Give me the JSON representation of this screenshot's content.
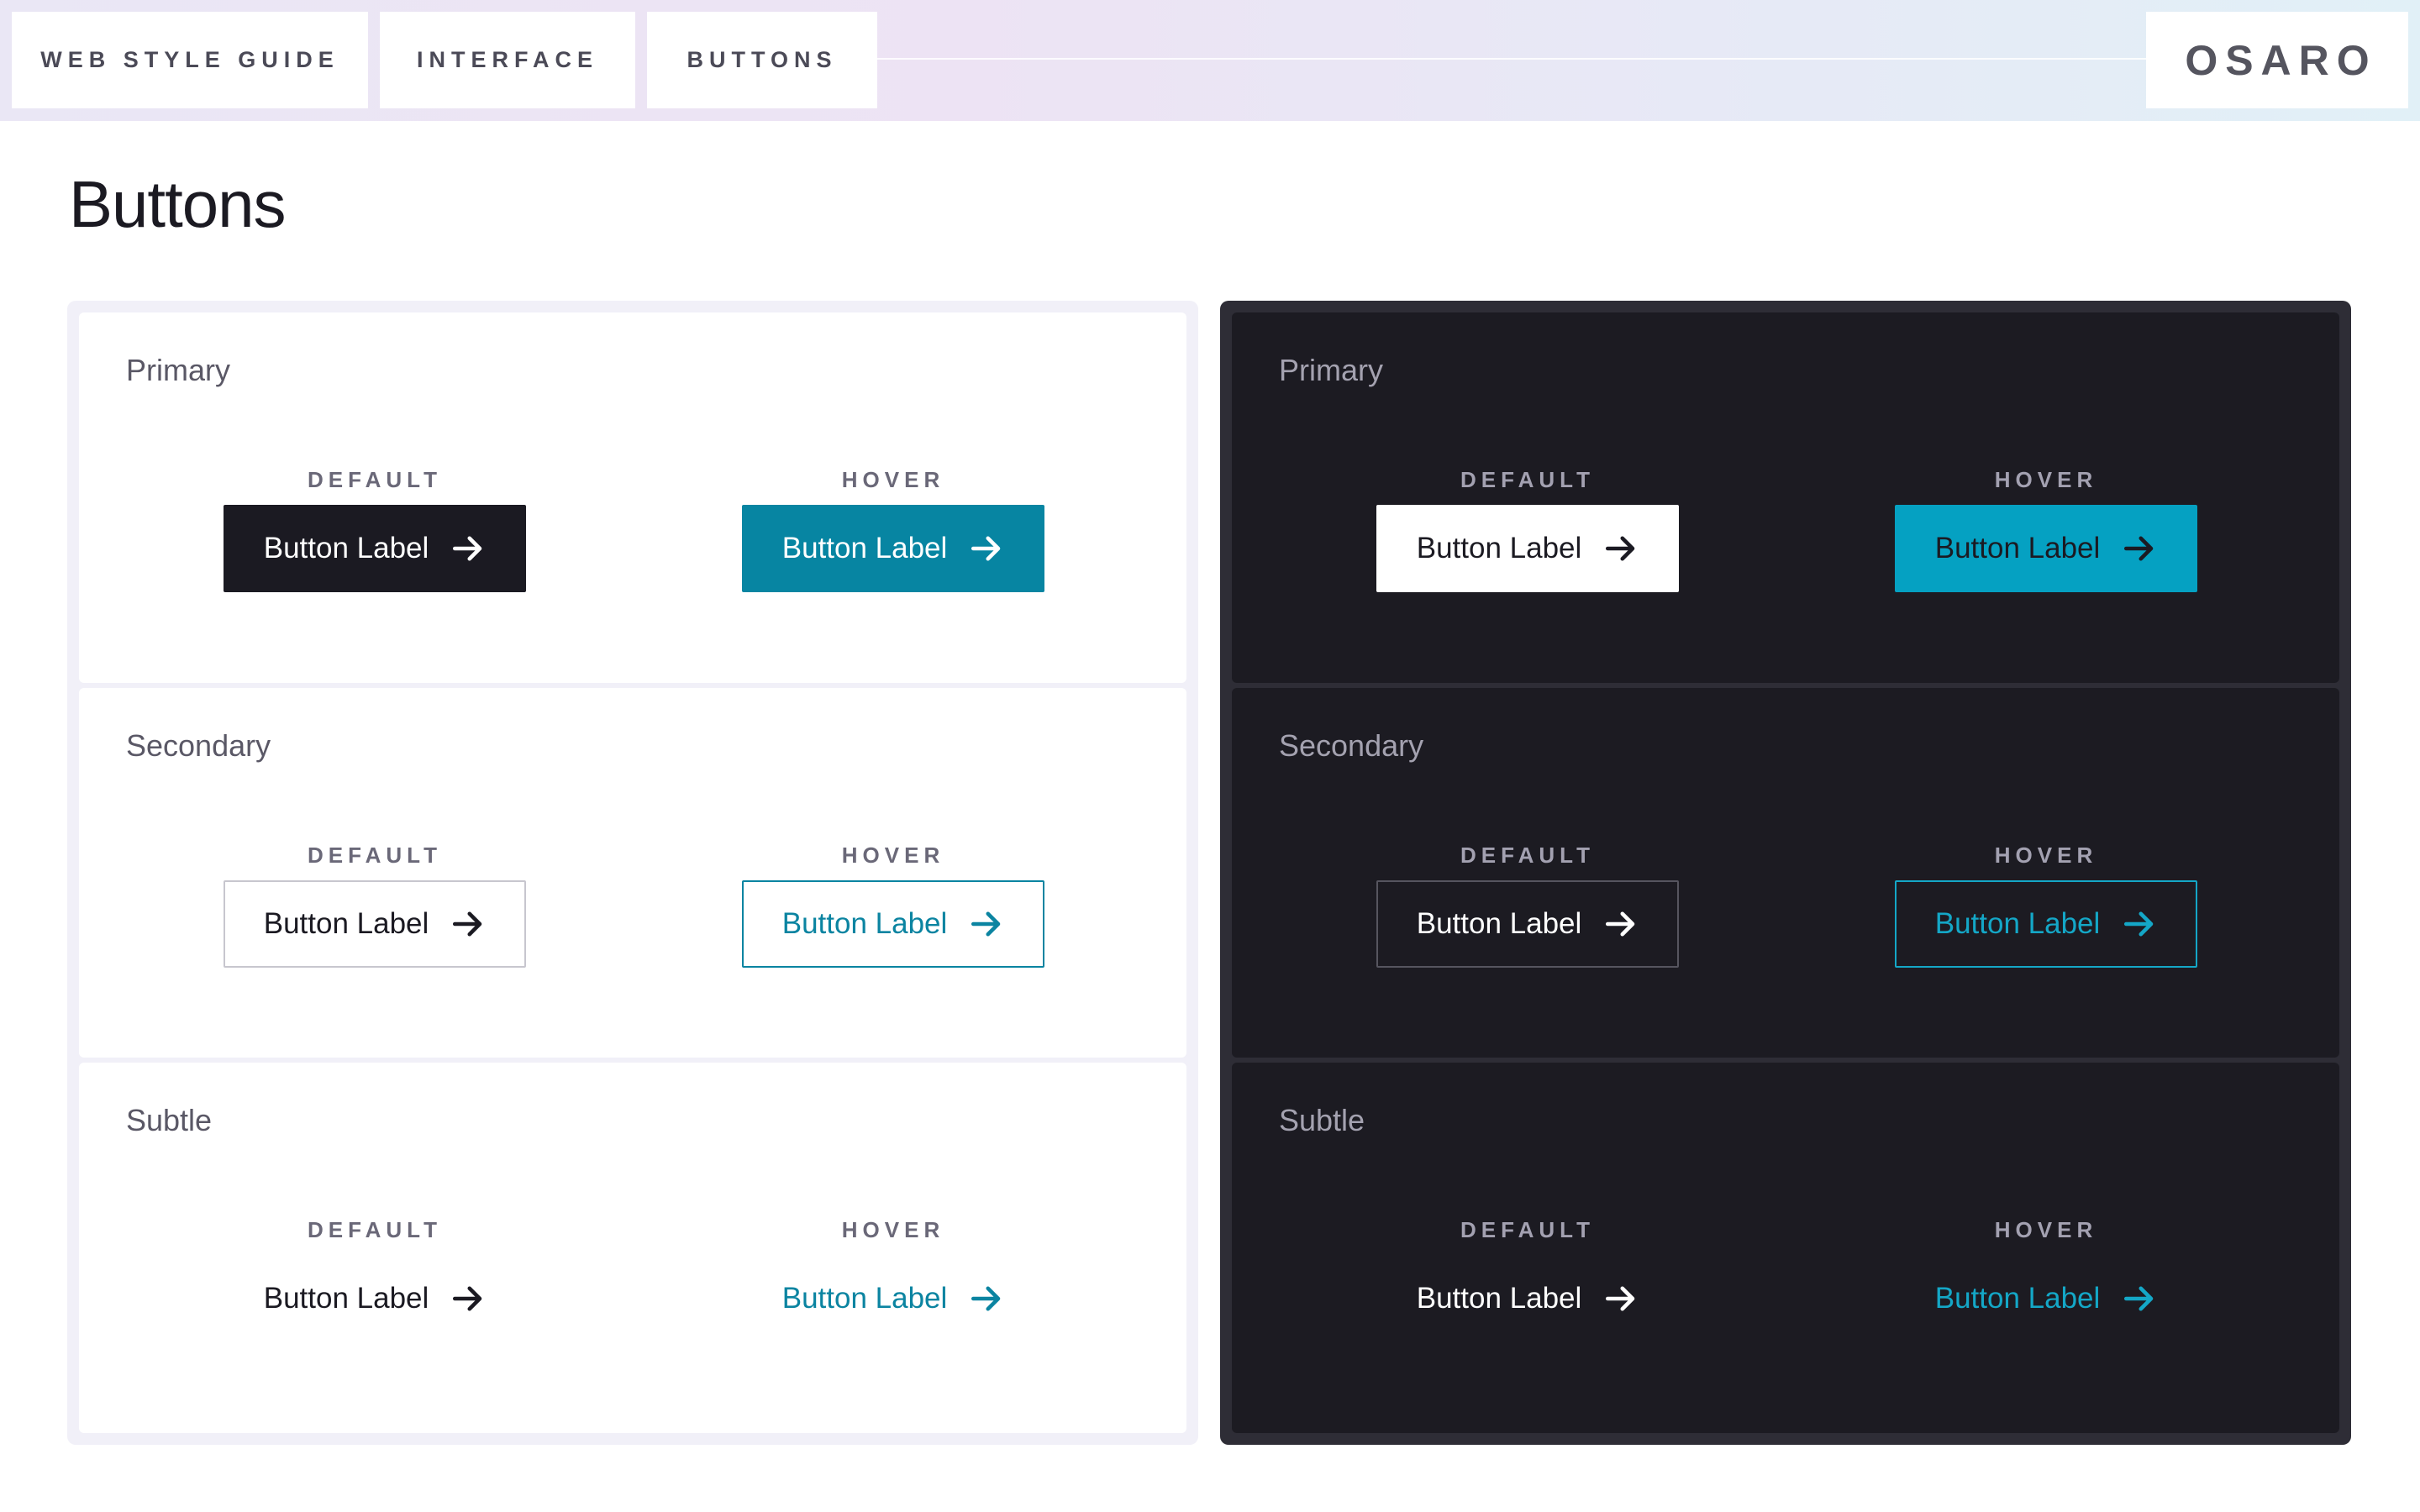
{
  "breadcrumbs": [
    "WEB STYLE GUIDE",
    "INTERFACE",
    "BUTTONS"
  ],
  "logo": "OSARO",
  "page_title": "Buttons",
  "colors": {
    "brand_teal": "#0785a2",
    "dark_surface": "#1c1b22",
    "hover_teal_dark": "#05a1c2"
  },
  "panels": {
    "light": {
      "sections": [
        {
          "label": "Primary",
          "default_state": "DEFAULT",
          "hover_state": "HOVER",
          "default_button": "Button Label",
          "hover_button": "Button Label",
          "icon": "arrow-right-icon"
        },
        {
          "label": "Secondary",
          "default_state": "DEFAULT",
          "hover_state": "HOVER",
          "default_button": "Button Label",
          "hover_button": "Button Label",
          "icon": "arrow-right-icon"
        },
        {
          "label": "Subtle",
          "default_state": "DEFAULT",
          "hover_state": "HOVER",
          "default_button": "Button Label",
          "hover_button": "Button Label",
          "icon": "arrow-right-icon"
        }
      ]
    },
    "dark": {
      "sections": [
        {
          "label": "Primary",
          "default_state": "DEFAULT",
          "hover_state": "HOVER",
          "default_button": "Button Label",
          "hover_button": "Button Label",
          "icon": "arrow-right-icon"
        },
        {
          "label": "Secondary",
          "default_state": "DEFAULT",
          "hover_state": "HOVER",
          "default_button": "Button Label",
          "hover_button": "Button Label",
          "icon": "arrow-right-icon"
        },
        {
          "label": "Subtle",
          "default_state": "DEFAULT",
          "hover_state": "HOVER",
          "default_button": "Button Label",
          "hover_button": "Button Label",
          "icon": "arrow-right-icon"
        }
      ]
    }
  }
}
